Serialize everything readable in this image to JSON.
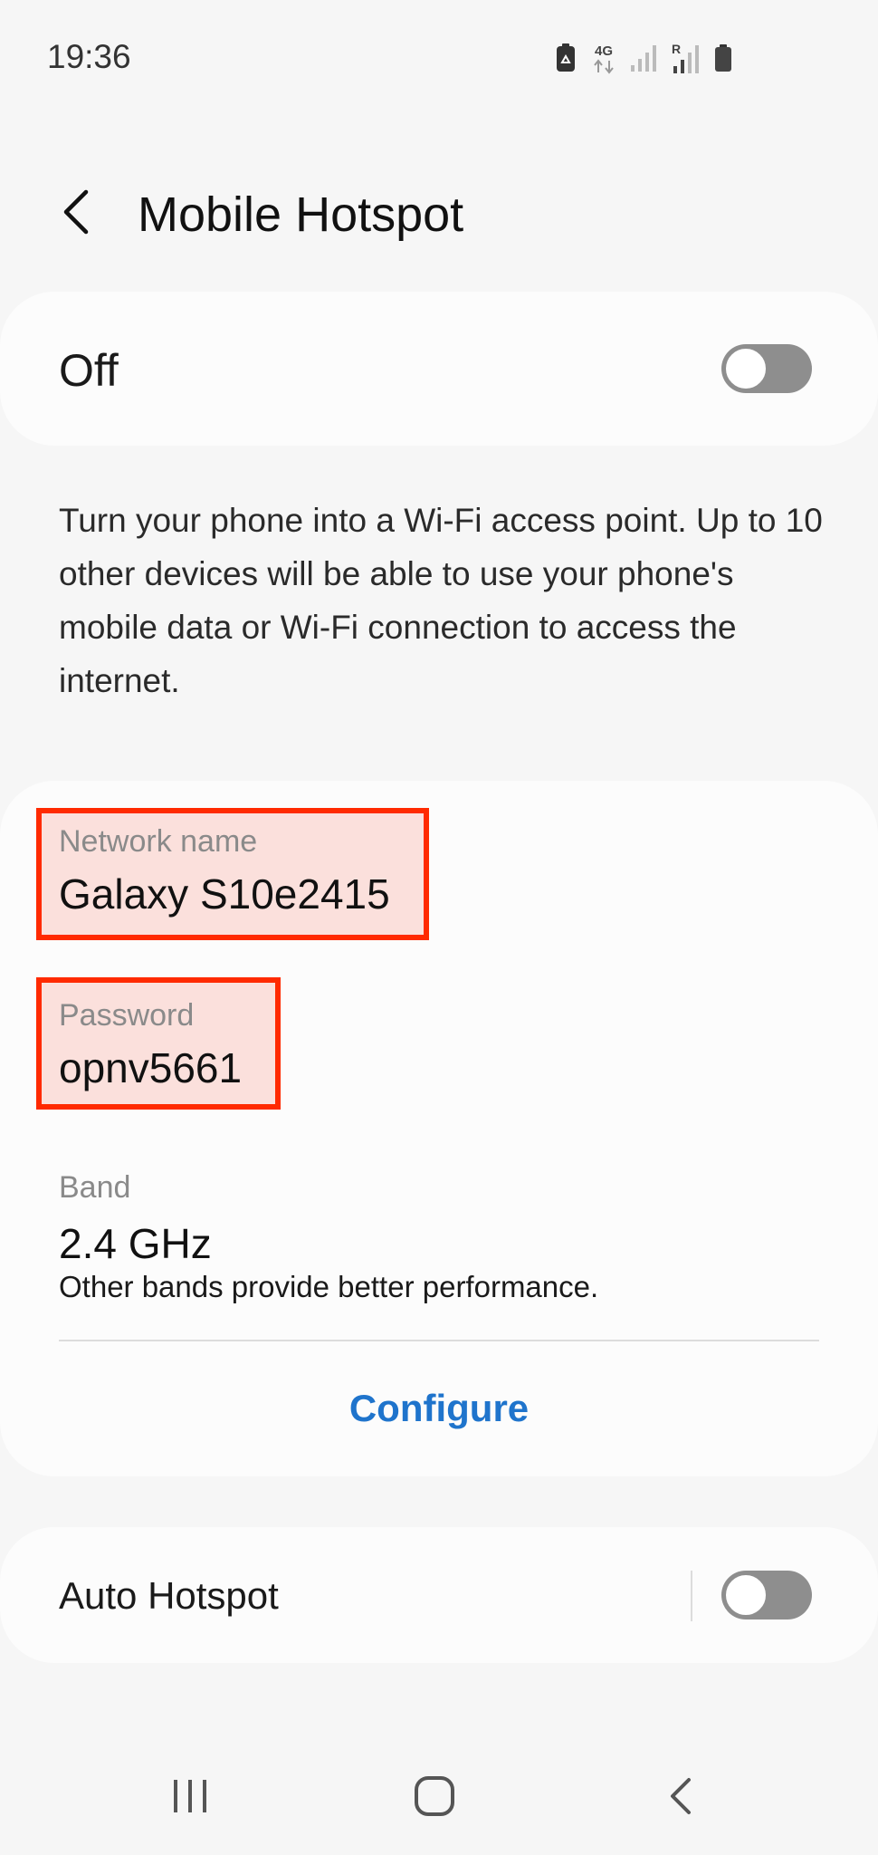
{
  "status_bar": {
    "time": "19:36",
    "icons": [
      "recycle-battery-icon",
      "4g-data-icon",
      "signal-icon",
      "roaming-signal-icon",
      "battery-icon"
    ],
    "network_type": "4G",
    "roaming_mark": "R"
  },
  "header": {
    "title": "Mobile Hotspot",
    "back_icon": "chevron-left-icon"
  },
  "main_toggle": {
    "label": "Off",
    "state": "off"
  },
  "description": "Turn your phone into a Wi-Fi access point. Up to 10 other devices will be able to use your phone's mobile data or Wi-Fi connection to access the internet.",
  "settings": {
    "network_name": {
      "label": "Network name",
      "value": "Galaxy S10e2415"
    },
    "password": {
      "label": "Password",
      "value": "opnv5661"
    },
    "band": {
      "label": "Band",
      "value": "2.4 GHz",
      "note": "Other bands provide better performance."
    },
    "configure_label": "Configure"
  },
  "auto_hotspot": {
    "label": "Auto Hotspot",
    "state": "off"
  },
  "nav_bar": {
    "icons": [
      "recents-icon",
      "home-icon",
      "back-icon"
    ]
  },
  "colors": {
    "accent": "#1f74cc",
    "highlight_border": "#ff2a00",
    "highlight_fill": "#fbe0dc",
    "toggle_off": "#8e8e8e",
    "background": "#f6f6f6",
    "card": "#fcfcfc"
  }
}
